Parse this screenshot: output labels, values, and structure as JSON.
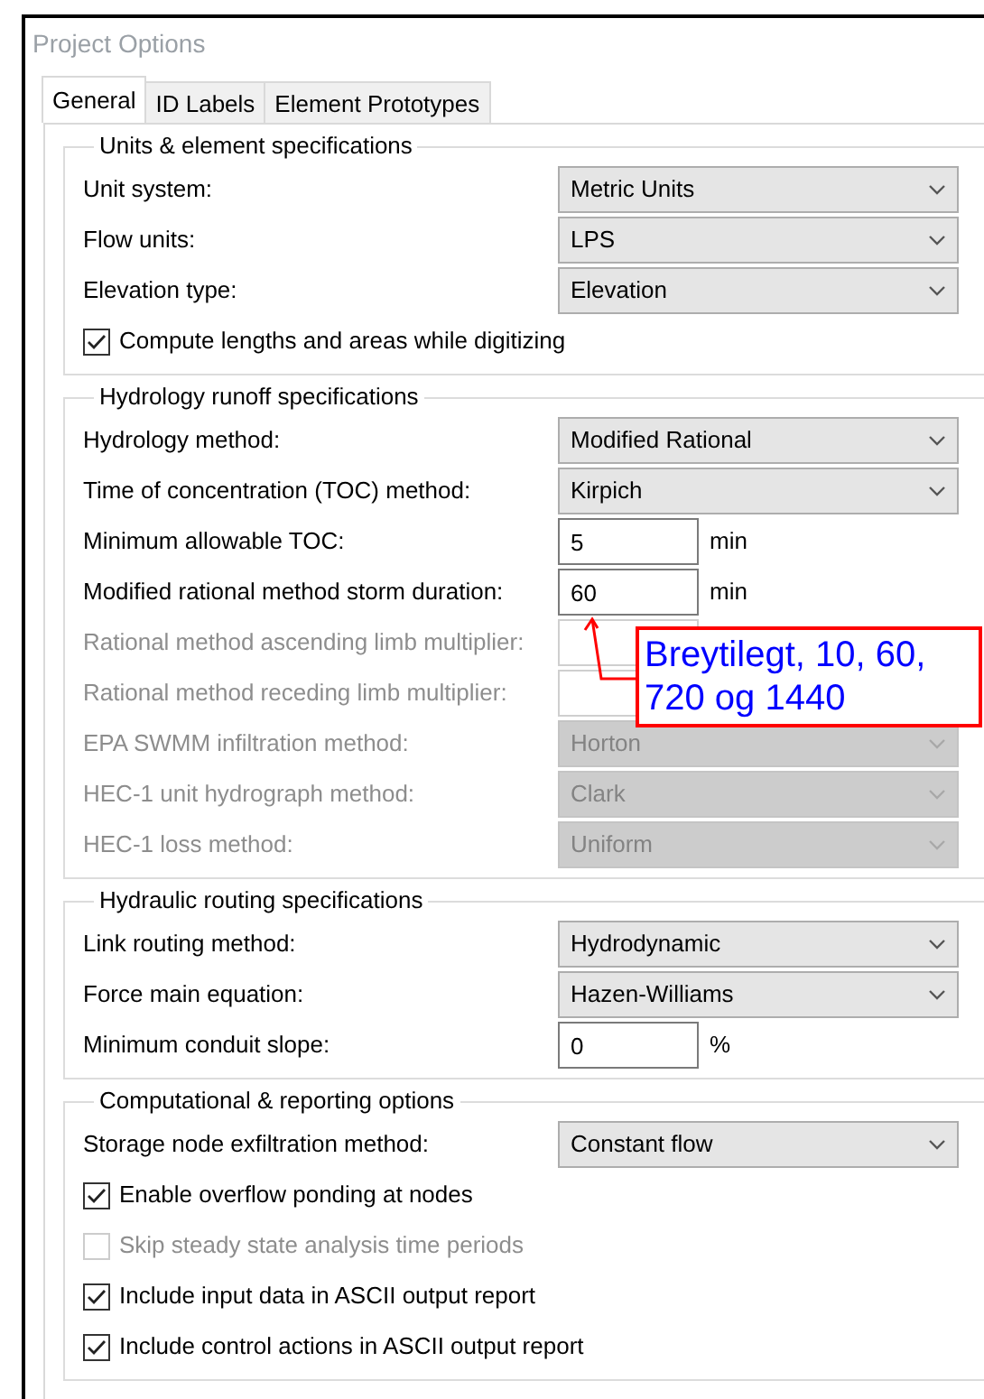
{
  "window": {
    "title": "Project Options"
  },
  "tabs": [
    {
      "label": "General",
      "selected": true
    },
    {
      "label": "ID Labels",
      "selected": false
    },
    {
      "label": "Element Prototypes",
      "selected": false
    }
  ],
  "groups": [
    {
      "title": "Units & element specifications",
      "rows": [
        {
          "kind": "select",
          "label": "Unit system:",
          "value": "Metric Units",
          "disabled": false
        },
        {
          "kind": "select",
          "label": "Flow units:",
          "value": "LPS",
          "disabled": false
        },
        {
          "kind": "select",
          "label": "Elevation type:",
          "value": "Elevation",
          "disabled": false
        },
        {
          "kind": "checkbox",
          "label": "Compute lengths and areas while digitizing",
          "checked": true,
          "disabled": false
        }
      ]
    },
    {
      "title": "Hydrology runoff specifications",
      "rows": [
        {
          "kind": "select",
          "label": "Hydrology method:",
          "value": "Modified Rational",
          "disabled": false
        },
        {
          "kind": "select",
          "label": "Time of concentration (TOC) method:",
          "value": "Kirpich",
          "disabled": false
        },
        {
          "kind": "input",
          "label": "Minimum allowable TOC:",
          "value": "5",
          "unit": "min",
          "disabled": false
        },
        {
          "kind": "input",
          "label": "Modified rational method storm duration:",
          "value": "60",
          "unit": "min",
          "disabled": false,
          "callout": "Breytilegt, 10, 60, 720 og 1440"
        },
        {
          "kind": "input",
          "label": "Rational method ascending limb multiplier:",
          "disabled": true
        },
        {
          "kind": "input",
          "label": "Rational method receding limb multiplier:",
          "disabled": true
        },
        {
          "kind": "select",
          "label": "EPA SWMM infiltration method:",
          "value": "Horton",
          "disabled": true
        },
        {
          "kind": "select",
          "label": "HEC-1 unit hydrograph method:",
          "value": "Clark",
          "disabled": true
        },
        {
          "kind": "select",
          "label": "HEC-1 loss method:",
          "value": "Uniform",
          "disabled": true
        }
      ]
    },
    {
      "title": "Hydraulic routing specifications",
      "rows": [
        {
          "kind": "select",
          "label": "Link routing method:",
          "value": "Hydrodynamic",
          "disabled": false
        },
        {
          "kind": "select",
          "label": "Force main equation:",
          "value": "Hazen-Williams",
          "disabled": false
        },
        {
          "kind": "input",
          "label": "Minimum conduit slope:",
          "value": "0",
          "unit": "%",
          "disabled": false
        }
      ]
    },
    {
      "title": "Computational & reporting options",
      "rows": [
        {
          "kind": "select",
          "label": "Storage node exfiltration method:",
          "value": "Constant flow",
          "disabled": false
        },
        {
          "kind": "checkbox",
          "label": "Enable overflow ponding at nodes",
          "checked": true,
          "disabled": false
        },
        {
          "kind": "checkbox",
          "label": "Skip steady state analysis time periods",
          "checked": false,
          "disabled": true
        },
        {
          "kind": "checkbox",
          "label": "Include input data in ASCII output report",
          "checked": true,
          "disabled": false
        },
        {
          "kind": "checkbox",
          "label": "Include control actions in ASCII output report",
          "checked": true,
          "disabled": false
        }
      ]
    }
  ]
}
